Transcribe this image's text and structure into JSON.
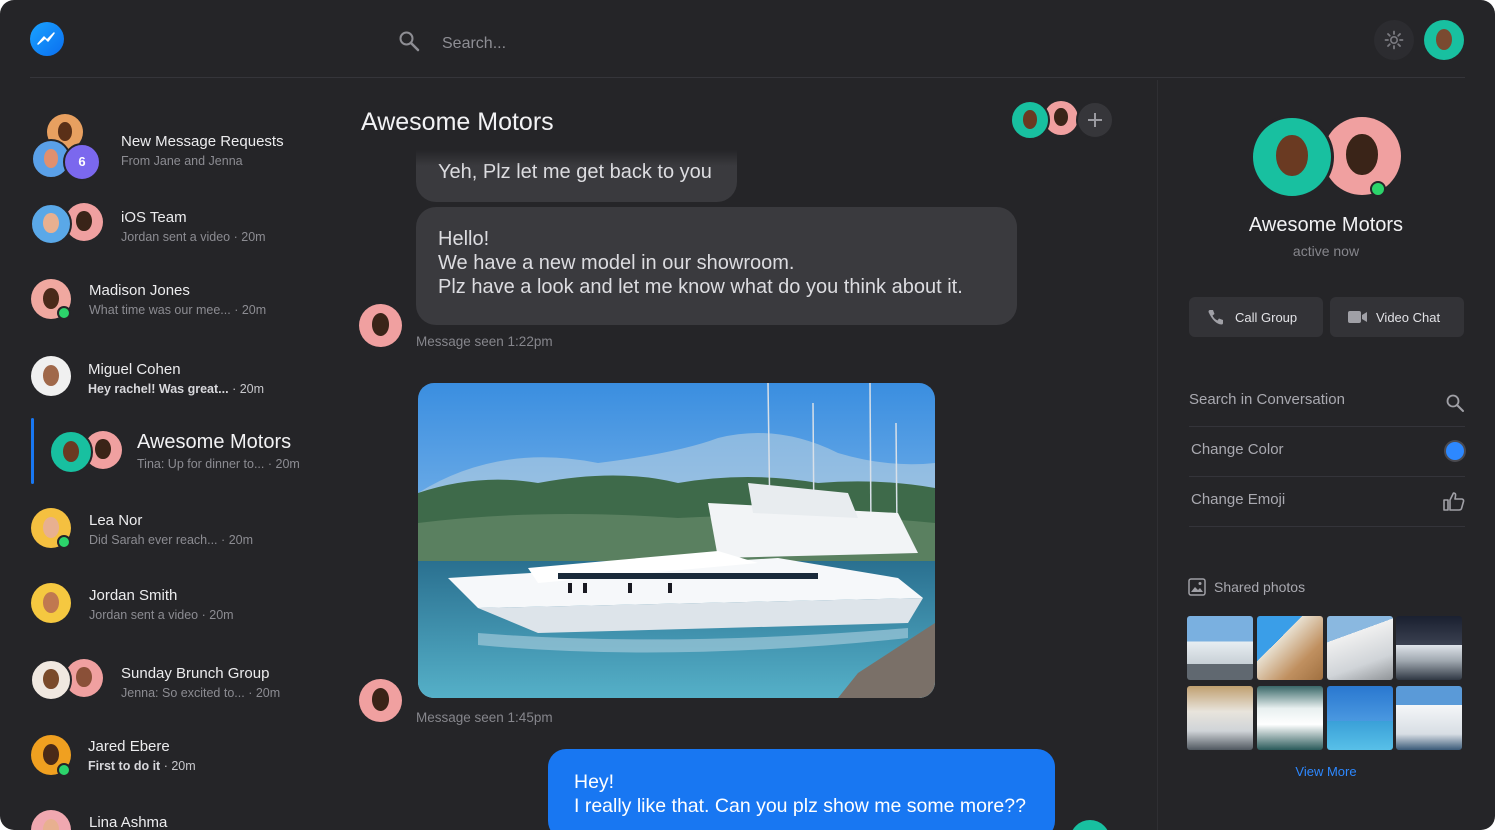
{
  "header": {
    "search_placeholder": "Search...",
    "logo_icon": "messenger-logo-icon",
    "settings_icon": "gear-icon"
  },
  "sidebar": {
    "conversations": [
      {
        "name": "New Message Requests",
        "preview": "From Jane and Jenna",
        "time": "",
        "badge": "6"
      },
      {
        "name": "iOS Team",
        "preview": "Jordan sent a video",
        "time": "20m"
      },
      {
        "name": "Madison Jones",
        "preview": "What time was our mee...",
        "time": "20m",
        "online": true
      },
      {
        "name": "Miguel Cohen",
        "preview": "Hey rachel! Was great...",
        "time": "20m",
        "unread": true
      },
      {
        "name": "Awesome Motors",
        "preview": "Tina: Up for dinner to...",
        "time": "20m",
        "active": true
      },
      {
        "name": "Lea Nor",
        "preview": "Did Sarah ever reach...",
        "time": "20m",
        "online": true
      },
      {
        "name": "Jordan Smith",
        "preview": "Jordan sent a video",
        "time": "20m"
      },
      {
        "name": "Sunday Brunch Group",
        "preview": "Jenna: So excited to...",
        "time": "20m"
      },
      {
        "name": "Jared Ebere",
        "preview": "First to do it",
        "time": "20m",
        "online": true,
        "unread": true
      },
      {
        "name": "Lina Ashma",
        "preview": "",
        "time": ""
      }
    ],
    "separator": "·"
  },
  "chat": {
    "title": "Awesome Motors",
    "messages": [
      {
        "text": "Yeh, Plz let me get back to you"
      },
      {
        "lines": [
          "Hello!",
          "We have a new model in our showroom.",
          "Plz have a look and let me know what do you think about it."
        ]
      },
      {
        "seen": "Message seen 1:22pm"
      },
      {
        "seen": "Message seen 1:45pm"
      },
      {
        "lines": [
          "Hey!",
          "I really like that. Can you plz show me some more??"
        ]
      }
    ],
    "add_icon": "plus-icon"
  },
  "details": {
    "name": "Awesome Motors",
    "status": "active now",
    "call_label": "Call Group",
    "video_label": "Video Chat",
    "search_label": "Search in Conversation",
    "color_label": "Change Color",
    "emoji_label": "Change Emoji",
    "shared_label": "Shared photos",
    "view_more": "View More",
    "accent_color": "#1877f2",
    "online_color": "#2cd46b"
  }
}
